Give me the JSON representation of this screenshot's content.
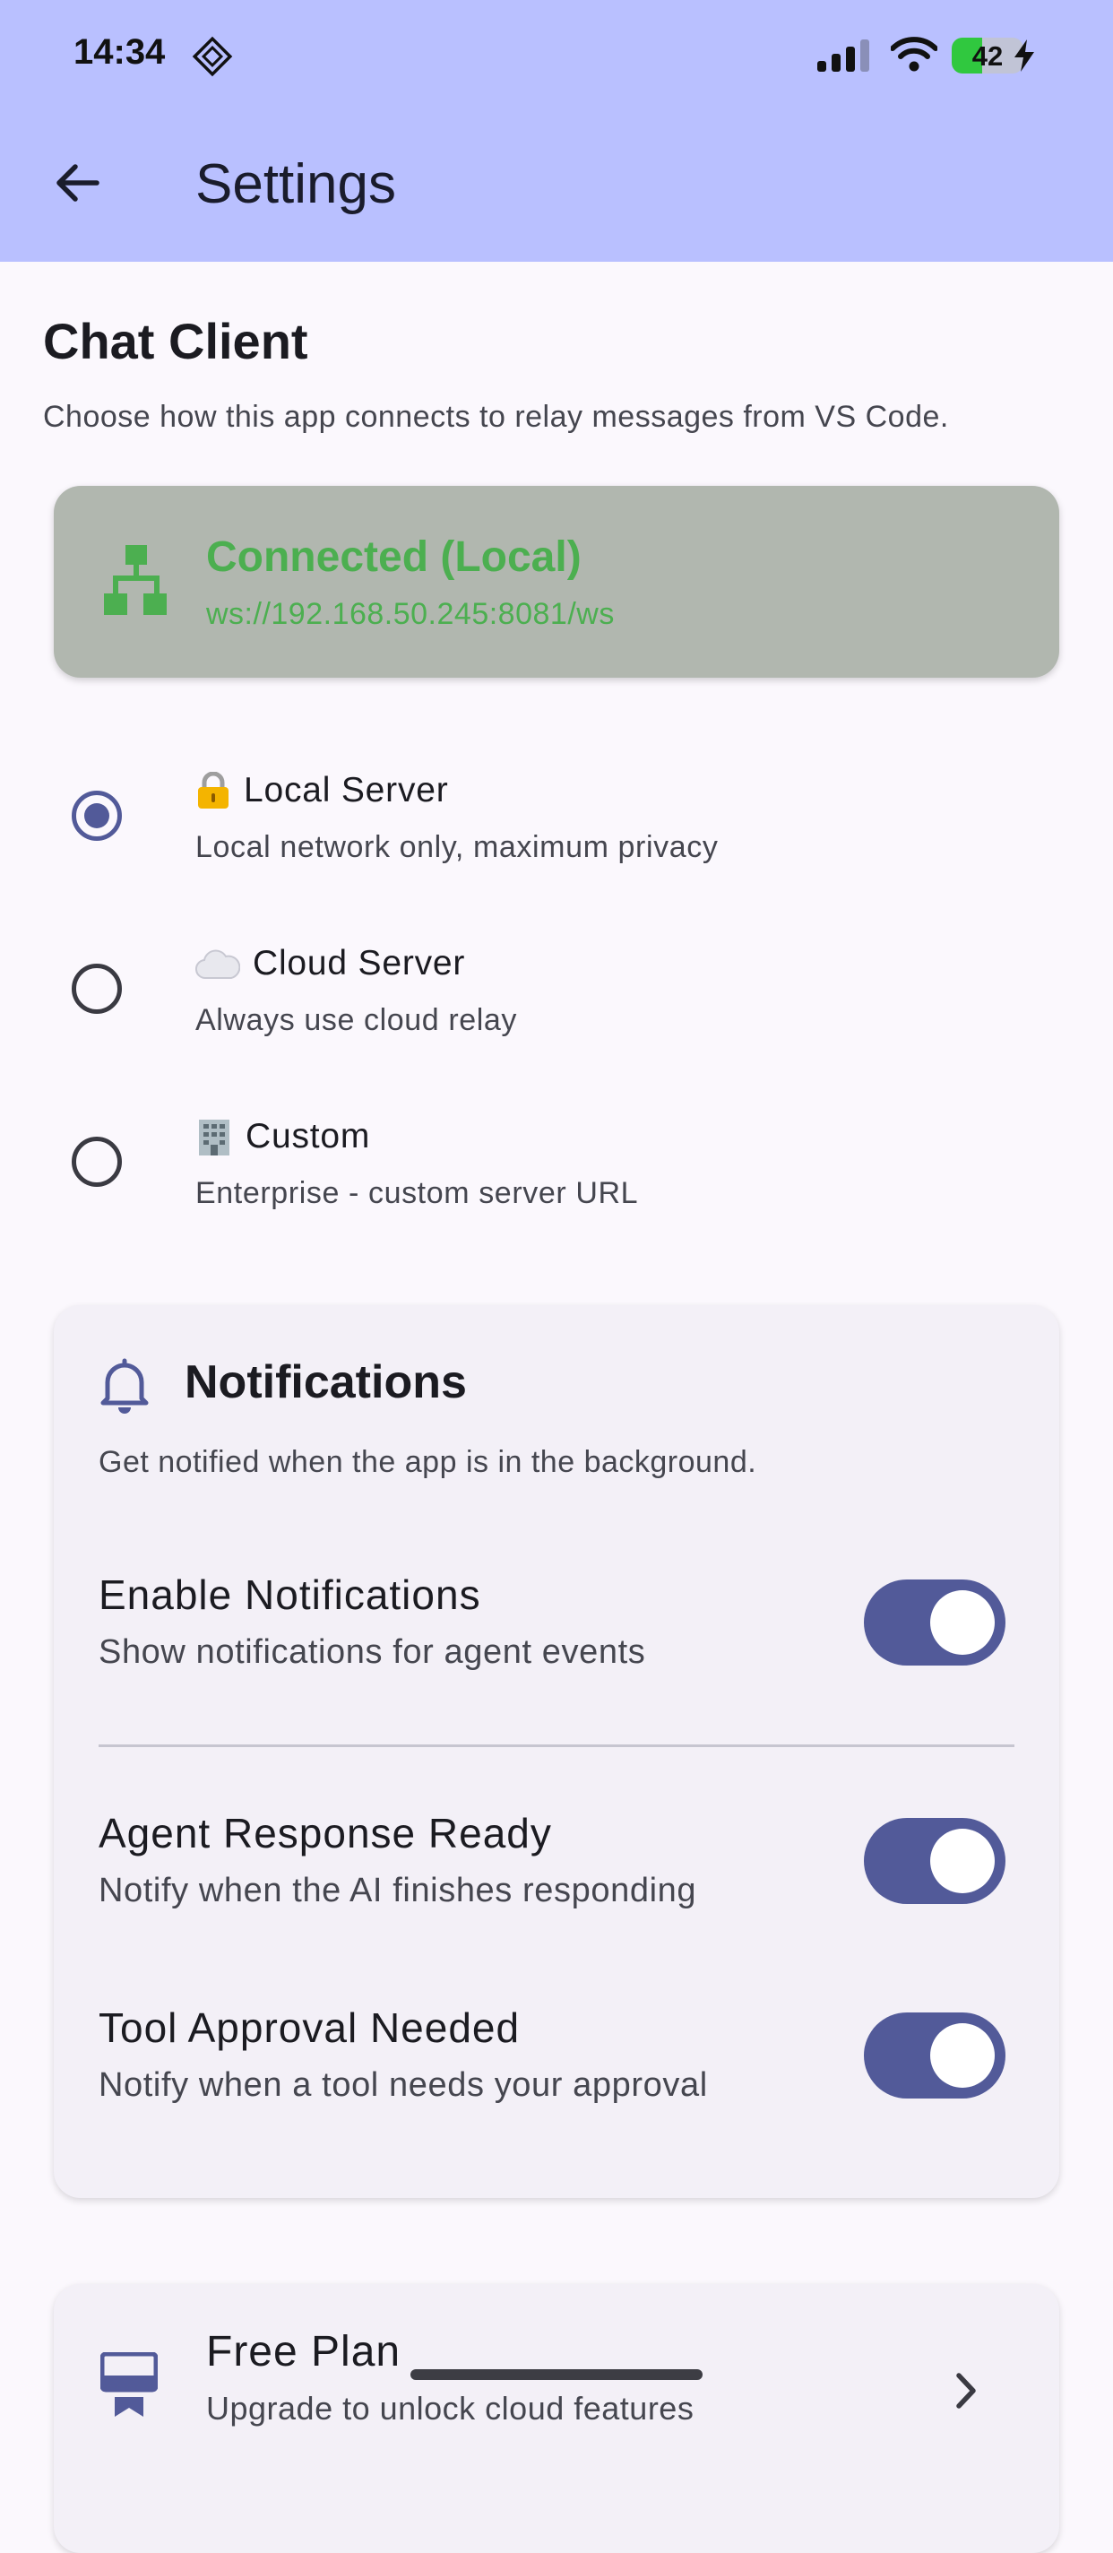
{
  "status_bar": {
    "time": "14:34",
    "battery_level": "42",
    "battery_fraction": 0.42
  },
  "app_bar": {
    "title": "Settings",
    "back_icon": "arrow-left-icon"
  },
  "chat_client": {
    "title": "Chat Client",
    "description": "Choose how this app connects to relay messages from VS Code.",
    "connection": {
      "status": "Connected (Local)",
      "url": "ws://192.168.50.245:8081/ws",
      "icon": "network-tree-icon",
      "status_color": "#4caf50"
    },
    "options": [
      {
        "icon": "lock-emoji",
        "label": "Local Server",
        "description": "Local network only, maximum privacy",
        "selected": true
      },
      {
        "icon": "cloud-emoji",
        "label": "Cloud Server",
        "description": "Always use cloud relay",
        "selected": false
      },
      {
        "icon": "office-building-emoji",
        "label": "Custom",
        "description": "Enterprise - custom server URL",
        "selected": false
      }
    ]
  },
  "notifications": {
    "icon": "bell-icon",
    "title": "Notifications",
    "description": "Get notified when the app is in the background.",
    "toggles": [
      {
        "title": "Enable Notifications",
        "subtitle": "Show notifications for agent events",
        "on": true
      },
      {
        "title": "Agent Response Ready",
        "subtitle": "Notify when the AI finishes responding",
        "on": true
      },
      {
        "title": "Tool Approval Needed",
        "subtitle": "Notify when a tool needs your approval",
        "on": true
      }
    ]
  },
  "plan": {
    "icon": "monitor-icon",
    "title": "Free Plan",
    "subtitle": "Upgrade to unlock cloud features",
    "chevron_icon": "chevron-right-icon"
  },
  "colors": {
    "app_bar": "#b9c0ff",
    "accent": "#525a99",
    "background": "#fbf8fd",
    "card": "#f3f0f7",
    "connection_card": "#b1b7af"
  }
}
